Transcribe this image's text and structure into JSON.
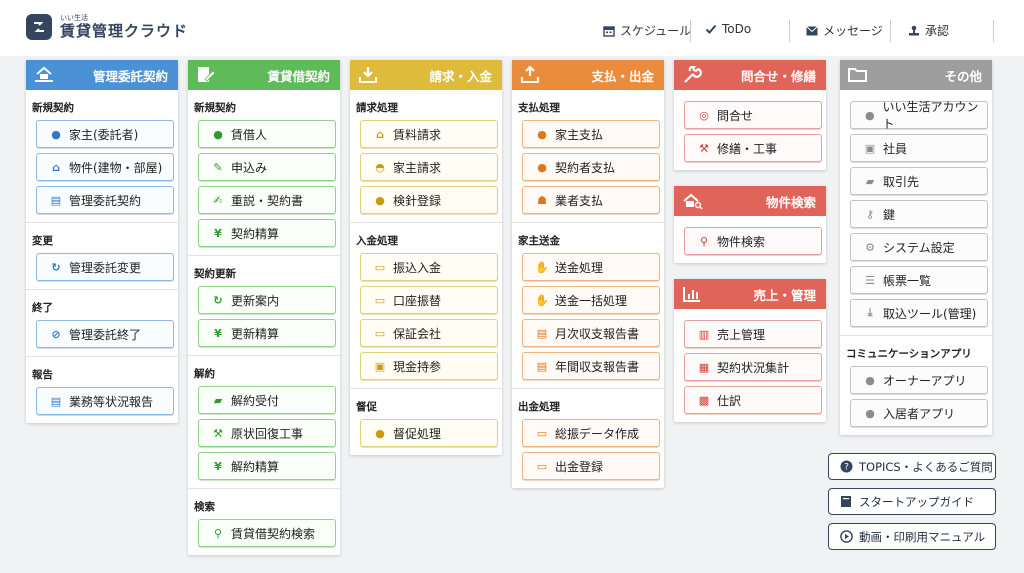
{
  "app": {
    "logo_sub": "いい生活",
    "logo_main": "賃貸管理クラウド"
  },
  "header_nav": [
    {
      "label": "スケジュール",
      "icon": "calendar-icon"
    },
    {
      "label": "ToDo",
      "icon": "check-icon"
    },
    {
      "label": "メッセージ",
      "icon": "envelope-icon"
    },
    {
      "label": "承認",
      "icon": "stamp-icon"
    }
  ],
  "columns": {
    "kanri": {
      "title": "管理委託契約",
      "sections": [
        {
          "label": "新規契約",
          "items": [
            "家主(委託者)",
            "物件(建物・部屋)",
            "管理委託契約"
          ]
        },
        {
          "label": "変更",
          "items": [
            "管理委託変更"
          ]
        },
        {
          "label": "終了",
          "items": [
            "管理委託終了"
          ]
        },
        {
          "label": "報告",
          "items": [
            "業務等状況報告"
          ]
        }
      ]
    },
    "chintai": {
      "title": "賃貸借契約",
      "sections": [
        {
          "label": "新規契約",
          "items": [
            "賃借人",
            "申込み",
            "重説・契約書",
            "契約精算"
          ]
        },
        {
          "label": "契約更新",
          "items": [
            "更新案内",
            "更新精算"
          ]
        },
        {
          "label": "解約",
          "items": [
            "解約受付",
            "原状回復工事",
            "解約精算"
          ]
        },
        {
          "label": "検索",
          "items": [
            "賃貸借契約検索"
          ]
        }
      ]
    },
    "seikyu": {
      "title": "請求・入金",
      "sections": [
        {
          "label": "請求処理",
          "items": [
            "賃料請求",
            "家主請求",
            "検針登録"
          ]
        },
        {
          "label": "入金処理",
          "items": [
            "振込入金",
            "口座振替",
            "保証会社",
            "現金持参"
          ]
        },
        {
          "label": "督促",
          "items": [
            "督促処理"
          ]
        }
      ]
    },
    "shiharai": {
      "title": "支払・出金",
      "sections": [
        {
          "label": "支払処理",
          "items": [
            "家主支払",
            "契約者支払",
            "業者支払"
          ]
        },
        {
          "label": "家主送金",
          "items": [
            "送金処理",
            "送金一括処理",
            "月次収支報告書",
            "年間収支報告書"
          ]
        },
        {
          "label": "出金処理",
          "items": [
            "総振データ作成",
            "出金登録"
          ]
        }
      ]
    },
    "toiawase": {
      "title": "問合せ・修繕",
      "items": [
        "問合せ",
        "修繕・工事"
      ]
    },
    "bukken": {
      "title": "物件検索",
      "items": [
        "物件検索"
      ]
    },
    "uriage": {
      "title": "売上・管理",
      "items": [
        "売上管理",
        "契約状況集計",
        "仕訳"
      ]
    },
    "sonota": {
      "title": "その他",
      "items": [
        "いい生活アカウント",
        "社員",
        "取引先",
        "鍵",
        "システム設定",
        "帳票一覧",
        "取込ツール(管理)"
      ],
      "apps_label": "コミュニケーションアプリ",
      "apps": [
        "オーナーアプリ",
        "入居者アプリ"
      ]
    }
  },
  "side_buttons": [
    "TOPICS・よくあるご質問",
    "スタートアップガイド",
    "動画・印刷用マニュアル"
  ],
  "colors": {
    "kanri": "#4a91d6",
    "chintai": "#5dbb5a",
    "seikyu": "#dfbb3b",
    "shiharai": "#e98c3c",
    "toiawase": "#e0645a",
    "sonota": "#9e9e9e",
    "brand": "#35455f"
  }
}
